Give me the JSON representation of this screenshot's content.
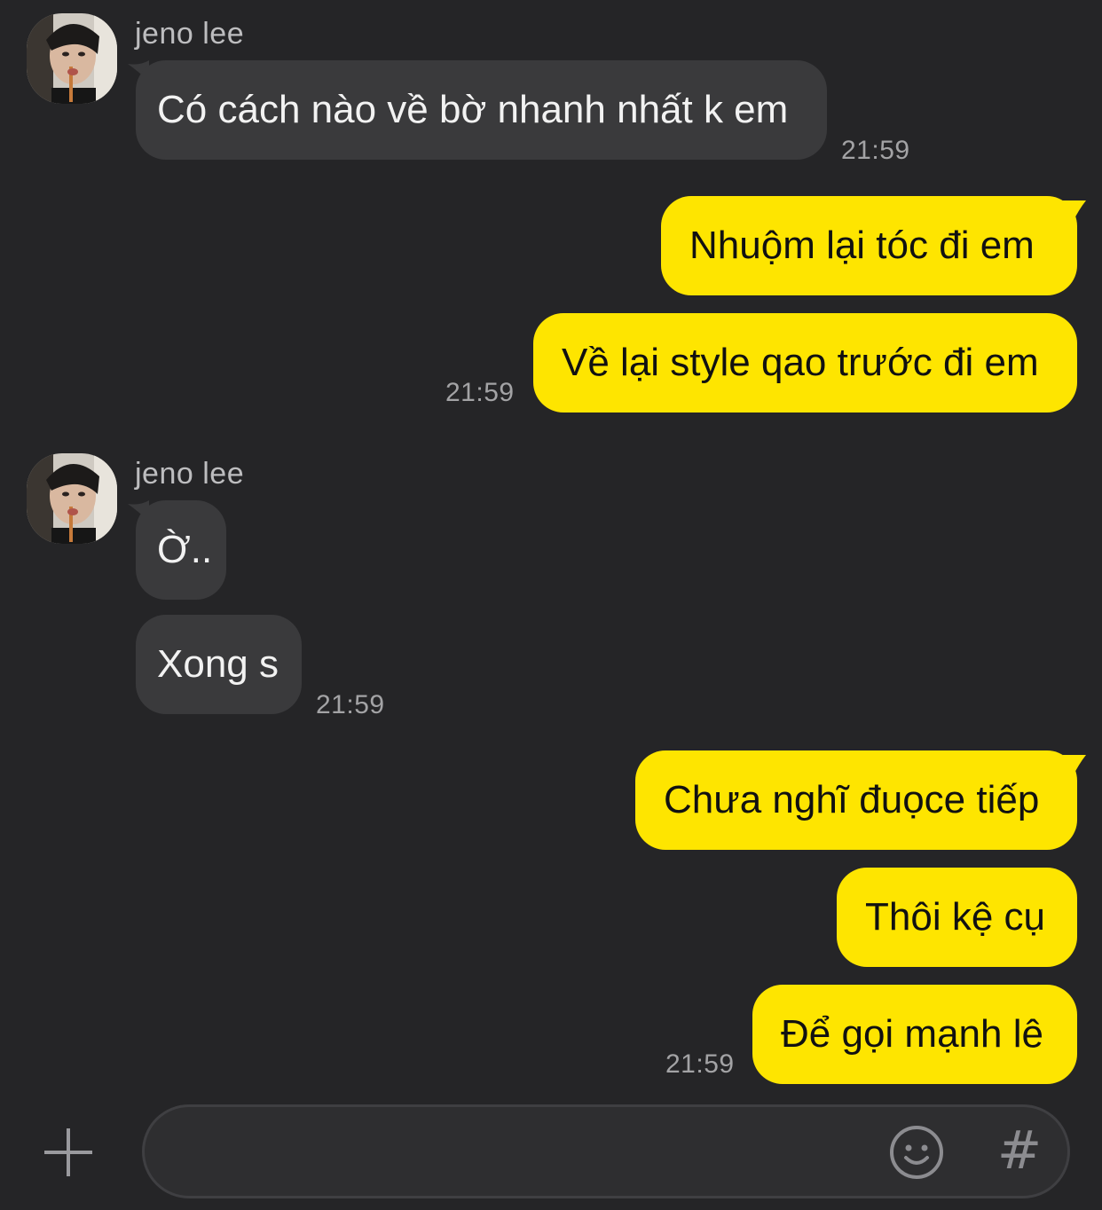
{
  "colors": {
    "background": "#252527",
    "incoming_bubble": "#3a3a3c",
    "outgoing_bubble": "#fee500"
  },
  "chat": {
    "groups": [
      {
        "sender": "jeno lee",
        "direction": "incoming",
        "avatar_icon": "profile-photo",
        "messages": [
          "Có cách nào về bờ nhanh nhất k em"
        ],
        "time": "21:59"
      },
      {
        "direction": "outgoing",
        "messages": [
          "Nhuộm lại tóc đi em",
          "Về lại style qao trước đi em"
        ],
        "time": "21:59"
      },
      {
        "sender": "jeno lee",
        "direction": "incoming",
        "avatar_icon": "profile-photo",
        "messages": [
          "Ờ..",
          "Xong s"
        ],
        "time": "21:59"
      },
      {
        "direction": "outgoing",
        "messages": [
          "Chưa nghĩ đuọce tiếp",
          "Thôi kệ cụ",
          "Để gọi mạnh lê"
        ],
        "time": "21:59"
      }
    ]
  },
  "composer": {
    "value": "",
    "placeholder": "",
    "plus_icon": "plus-icon",
    "emoji_icon": "emoji-icon",
    "hash_label": "#"
  }
}
